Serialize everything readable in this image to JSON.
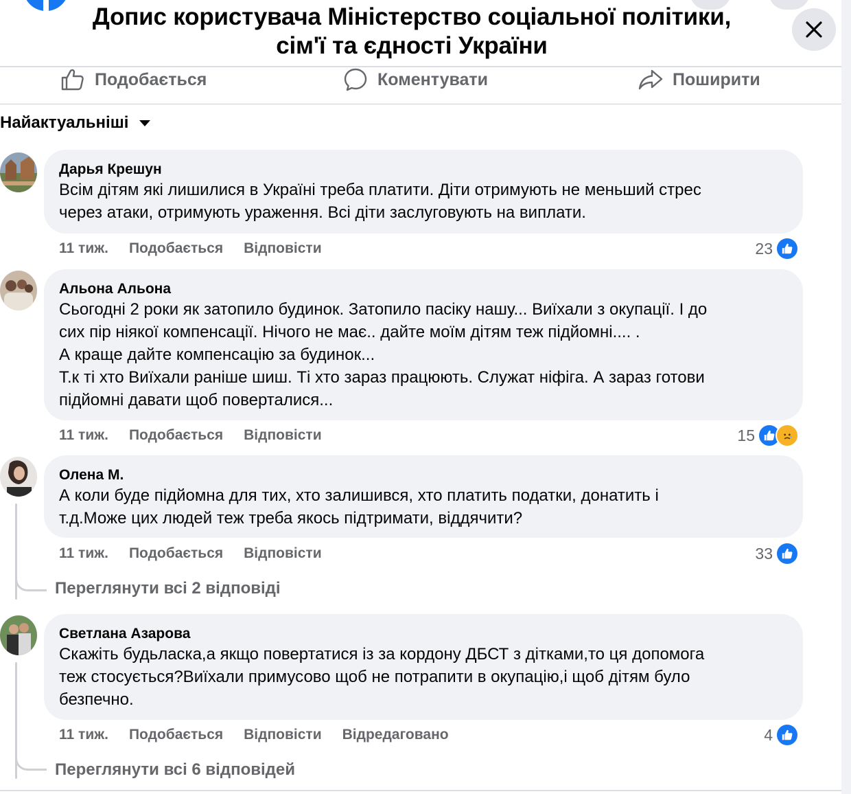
{
  "header": {
    "title_line1": "Допис користувача Міністерство соціальної політики,",
    "title_line2": "сім'ї та єдності України"
  },
  "actions": {
    "like": "Подобається",
    "comment": "Коментувати",
    "share": "Поширити"
  },
  "sort": {
    "label": "Найактуальніші"
  },
  "comments": [
    {
      "author": "Дарья Крешун",
      "text": "Всім дітям які лишилися в Україні треба платити. Діти отримують не меньший стрес\nчерез атаки, отримують ураження. Всі діти заслуговують на виплати.",
      "time": "11 тиж.",
      "like": "Подобається",
      "reply": "Відповісти",
      "reactions": "23"
    },
    {
      "author": "Альона Альона",
      "text": "Сьогодні 2 роки як затопило будинок. Затопило пасіку нашу... Виїхали з окупації. І до\nсих пір ніякої компенсації. Нічого не має.. дайте моїм дітям теж підйомні.... .\nА краще дайте компенсацію за будинок...\nТ.к ті хто Виїхали раніше шиш. Ті хто зараз працюють. Служат ніфіга. А зараз готови\nпідйомні давати щоб поверталися...",
      "time": "11 тиж.",
      "like": "Подобається",
      "reply": "Відповісти",
      "reactions": "15"
    },
    {
      "author": "Олена М.",
      "text": "А коли буде підйомна для тих, хто залишився, хто платить податки, донатить і\nт.д.Може цих людей теж треба якось підтримати, віддячити?",
      "time": "11 тиж.",
      "like": "Подобається",
      "reply": "Відповісти",
      "reactions": "33",
      "view_replies": "Переглянути всі 2 відповіді"
    },
    {
      "author": "Светлана Азарова",
      "text": "Скажіть будьласка,а якщо повертатися із за кордону ДБСТ з дітками,то ця допомога\nтеж стосується?Виїхали примусово щоб не потрапити в окупацію,і щоб дітям було\nбезпечно.",
      "time": "11 тиж.",
      "like": "Подобається",
      "reply": "Відповісти",
      "edited": "Відредаговано",
      "reactions": "4",
      "view_replies": "Переглянути всі 6 відповідей"
    }
  ],
  "colors": {
    "accent": "#1877f2",
    "bubble": "#f0f2f5",
    "secondary_text": "#65676b",
    "sad_reaction": "#f7b125"
  },
  "icons": [
    "facebook-logo",
    "close-icon",
    "thumbs-up-icon",
    "comment-bubble-icon",
    "share-arrow-icon",
    "caret-down-icon",
    "like-reaction-icon",
    "sad-reaction-icon"
  ]
}
